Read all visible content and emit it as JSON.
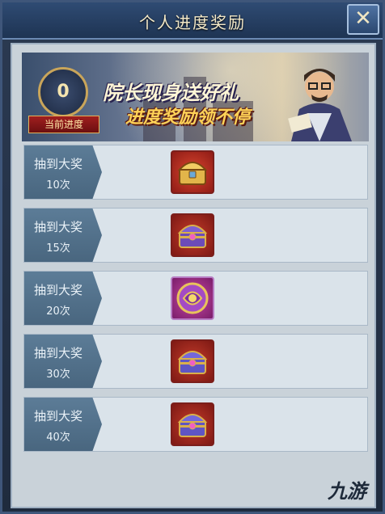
{
  "window": {
    "title": "个人进度奖励",
    "close_symbol": "✕"
  },
  "banner": {
    "progress_value": "0",
    "progress_label": "当前进度",
    "headline_1": "院长现身送好礼",
    "headline_2": "进度奖励领不停"
  },
  "rewards": [
    {
      "label": "抽到大奖",
      "count": "10次",
      "chest": "gold-chest"
    },
    {
      "label": "抽到大奖",
      "count": "15次",
      "chest": "purple-chest"
    },
    {
      "label": "抽到大奖",
      "count": "20次",
      "chest": "magenta-orb-chest"
    },
    {
      "label": "抽到大奖",
      "count": "30次",
      "chest": "purple-chest"
    },
    {
      "label": "抽到大奖",
      "count": "40次",
      "chest": "purple-chest"
    }
  ],
  "watermark": "九游",
  "colors": {
    "title_text": "#f3e9c8",
    "row_label_bg": "#5c7c97",
    "panel_bg": "#c9d2d9",
    "accent_gold": "#ffd257"
  }
}
